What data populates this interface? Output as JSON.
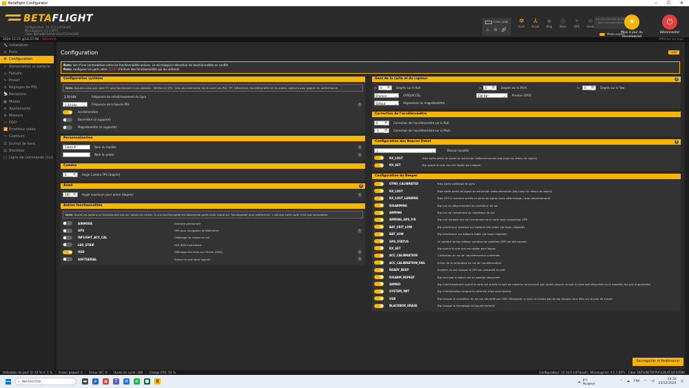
{
  "window": {
    "title": "Betaflight Configurator",
    "min": "–",
    "max": "☐",
    "close": "✕"
  },
  "logo": {
    "beta": "BETA",
    "flight": "FLIGHT",
    "lines": [
      "Configurateur: 10.10.0 (c97dea0)",
      "Micrologiciel: 4.5.1 BTFL",
      "Cible: BEFH/BETAFPVF435(AT32F435M)"
    ]
  },
  "status": {
    "battery": "0.00V (USB)",
    "icons": [
      "⚠",
      "⚙",
      "🔗"
    ]
  },
  "sensors": [
    {
      "icon": "gyro-icon",
      "glyph": "✲",
      "label": "Gyro",
      "on": true
    },
    {
      "icon": "accel-icon",
      "glyph": "⅄",
      "label": "Accel",
      "on": true
    },
    {
      "icon": "mag-icon",
      "glyph": "◈",
      "label": "Mag",
      "on": false
    },
    {
      "icon": "baro-icon",
      "glyph": "◎",
      "label": "Baro",
      "on": false
    },
    {
      "icon": "gps-icon",
      "glyph": "⌖",
      "label": "GPS",
      "on": false
    },
    {
      "icon": "sonar-icon",
      "glyph": "≋",
      "label": "Sonar",
      "on": false
    }
  ],
  "rec": "Aucune mémoire de flash pour l'enregistrement",
  "expert_mode": "Mode expert",
  "buttons": {
    "update": "Mise à jour du micrologiciel",
    "disconnect": "Déconnecter"
  },
  "subbar": {
    "datetime": "2024-12-25 @14:27:08 –",
    "disarmed": "Désarmé",
    "logs": "Afficher les logs"
  },
  "nav": [
    {
      "icon": "🔧",
      "label": "Installation"
    },
    {
      "icon": "⇆",
      "label": "Ports"
    },
    {
      "icon": "⚙",
      "label": "Configuration",
      "active": true
    },
    {
      "icon": "⚡",
      "label": "Alimentation et batterie"
    },
    {
      "icon": "⚠",
      "label": "Failsafe"
    },
    {
      "icon": "✎",
      "label": "Preset"
    },
    {
      "icon": "≡",
      "label": "Réglages de PID"
    },
    {
      "icon": "📡",
      "label": "Récepteur"
    },
    {
      "icon": "▦",
      "label": "Modes"
    },
    {
      "icon": "✲",
      "label": "Ajustements"
    },
    {
      "icon": "⚙",
      "label": "Moteurs"
    },
    {
      "icon": "▭",
      "label": "OSD"
    },
    {
      "icon": "📶",
      "label": "Émetteur vidéo"
    },
    {
      "icon": "〜",
      "label": "Capteurs"
    },
    {
      "icon": "☰",
      "label": "Journal de bord"
    },
    {
      "icon": "▤",
      "label": "Blackbox"
    },
    {
      "icon": "▢",
      "label": "Ligne de commande (CLI)"
    }
  ],
  "page": {
    "title": "Configuration",
    "wiki": "WIKI",
    "note1_bold": "Note:",
    "note1": " lors d'une contradiction entre les fonctionnalités actives. Le micrologiciel désactive les fonctionnalités en conflit!",
    "note2_bold": "Note:",
    "note2a": " configurer les ports série ",
    "note2_red": "AVANT",
    "note2b": " d'activer des fonctionnalités qui les utilisent."
  },
  "system": {
    "title": "Configuration système",
    "note_bold": "Note:",
    "note": " Assurez-vous que votre FC peut fonctionner à ces vitesses ! Vérifiez le CPU. Cela peut demander de re-tuner ses PID. TIP: Désactivez l'accéléromètre et les autres capteurs pour gagner en performance.",
    "gyro_rate": "3.20 kHz",
    "gyro_rate_label": "Fréquence de rafraîchissement du Gyro",
    "pid_rate": "3.20 kHz",
    "pid_rate_label": "Fréquence de la boucle PID",
    "accel": "Accéléromètre",
    "baro": "Baromètre (si supporté)",
    "mag": "Magnétomètre (si supporté)"
  },
  "personal": {
    "title": "Personnalisation",
    "craft_value": "Cobra X",
    "craft_label": "Nom du modèle",
    "pilot_value": "",
    "pilot_label": "Nom du pilote"
  },
  "camera": {
    "title": "Caméra",
    "value": "0",
    "label": "Angle Caméra FPV [degrés]"
  },
  "arming": {
    "title": "Armé",
    "value": "180",
    "label": "Angle maximum pour armer [degrés]"
  },
  "features": {
    "title": "Autres fonctionnalités",
    "note_bold": "Note:",
    "note": " toutes les options ne fonctionnent pas sur toutes les cartes. Si une fonctionnalité est désactivée après avoir cliqué sur 'Sauvegarder puis redémarrer', c'est que votre carte n'est pas compatible.",
    "items": [
      {
        "name": "AIRMODE",
        "desc": "Airmode permanent",
        "on": false,
        "help": false
      },
      {
        "name": "GPS",
        "desc": "GPS pour navigation et télémétrie",
        "on": false,
        "help": true
      },
      {
        "name": "INFLIGHT_ACC_CAL",
        "desc": "Calibrage du niveau en vol",
        "on": false,
        "help": false
      },
      {
        "name": "LED_STRIP",
        "desc": "LED RGB multicolore",
        "on": false,
        "help": false
      },
      {
        "name": "OSD",
        "desc": "Affichage des infos sur l'écran (OSD)",
        "on": true,
        "help": true
      },
      {
        "name": "SOFTSERIAL",
        "desc": "Activer le port série logiciel",
        "on": false,
        "help": true
      }
    ]
  },
  "alignment": {
    "title": "Sens de la carte et du capteur",
    "roll_value": "0",
    "roll_label": "Degrés sur le Roll",
    "pitch_value": "0",
    "pitch_label": "Degrés sur le Pitch",
    "yaw_value": "0",
    "yaw_label": "Degrés sur le Yaw",
    "gyro_first": "Premier",
    "gyro_first_label": "GYRO/ACCEL",
    "gyro_align": "CW 90°",
    "gyro_align_label": "Premier GYRO",
    "mag_align": "Défaut",
    "mag_align_label": "Alignement du magnétomètre"
  },
  "acc_trim": {
    "title": "Correction de l'accéléromètre",
    "roll_value": "0",
    "roll_label": "Correction de l'accéléromètre sur le Roll",
    "pitch_value": "-1",
    "pitch_label": "Correction de l'accéléromètre sur le Pitch"
  },
  "dshot": {
    "title": "Configuration des Beacon Dshot",
    "tone": "1",
    "tone_label": "Beacon tonalité",
    "items": [
      {
        "name": "RX_LOST",
        "desc": "Bips après perte de signal ou extinction radiocommande (bip jusqu'au retour du signal)",
        "on": true
      },
      {
        "name": "RX_SET",
        "desc": "Bip quand le voie aux est réglée pour bipper",
        "on": true
      }
    ]
  },
  "beeper": {
    "title": "Configuration du Beeper",
    "items": [
      {
        "name": "GYRO_CALIBRATED",
        "desc": "Bips après calibrage du gyro"
      },
      {
        "name": "RX_LOST",
        "desc": "Bips après perte de signal ou extinction radiocommande (bip jusqu'au retour du signal)"
      },
      {
        "name": "RX_LOST_LANDING",
        "desc": "Bips SOS si machine armée et perte de signal (auto atterrissage / auto désarmement)"
      },
      {
        "name": "DISARMING",
        "desc": "Bip lors du désarmement du contrôleur de vol"
      },
      {
        "name": "ARMING",
        "desc": "Bip lors de l'armement du contrôleur de vol"
      },
      {
        "name": "ARMING_GPS_FIX",
        "desc": "Bip une mélodie lors de l'armement de la carte avec acquisition GPS"
      },
      {
        "name": "BAT_CRIT_LOW",
        "desc": "Bip avertisseur insistant sur batterie très faible (de façon réglable)"
      },
      {
        "name": "BAT_LOW",
        "desc": "Bip avertisseur sur batterie faible (de façon réglable)"
      },
      {
        "name": "GPS_STATUS",
        "desc": "Le nombre de bip indique combien de satellites GPS ont été trouvés"
      },
      {
        "name": "RX_SET",
        "desc": "Bip quand le voie aux est réglée pour bipper"
      },
      {
        "name": "ACC_CALIBRATION",
        "desc": "Calibration en vol de l'accéléromètre confirmée"
      },
      {
        "name": "ACC_CALIBRATION_FAIL",
        "desc": "Échec de la calibration en vol de l'accéléromètre"
      },
      {
        "name": "READY_BEEP",
        "desc": "Émettre un son lorsque le GPS est verrouillé et prêt"
      },
      {
        "name": "DISARM_REPEAT",
        "desc": "Bip tant que le switch est en position désarmée"
      },
      {
        "name": "ARMED",
        "desc": "Bip d'avertissement quand la carte est armée et que les moteurs ne tournent pas (actifs jusqu'à ce que la carte soit désarmée ou la manette des gaz augmentée)"
      },
      {
        "name": "SYSTEM_INIT",
        "desc": "Bip d'initialisation lorsque la carte est mise sous tension"
      },
      {
        "name": "USB",
        "desc": "Bip lorsque le contrôleur de vol est alimenté par USB. Désactiver si vous ne voulez pas de bip lorsque vous êtes sur le plan de travail"
      },
      {
        "name": "BLACKBOX_ERASE",
        "desc": "Bip lorsque le formatage du log est terminé"
      }
    ]
  },
  "save": "Sauvegarder et Redémarrer",
  "statusbar": {
    "port": "Utilisation du port: D: 15 % U: 1 %",
    "packet": "Erreur paquet: 0",
    "i2c": "Erreur I2C: 0",
    "cycle": "Durée de cycle: 306",
    "cpu": "Charge CPU: 53 %",
    "version": "Configurateur: 10.10.0 (c97dea0) , Micrologiciel: 4.5.1 BTFL , Cible: BEFH/BETAFPVF435(AT32F435M)"
  },
  "taskbar": {
    "search": "Rechercher",
    "temp": "8°C",
    "weather": "Nuageux",
    "lang": "FRA",
    "time": "14:33",
    "date": "25/12/2024"
  }
}
